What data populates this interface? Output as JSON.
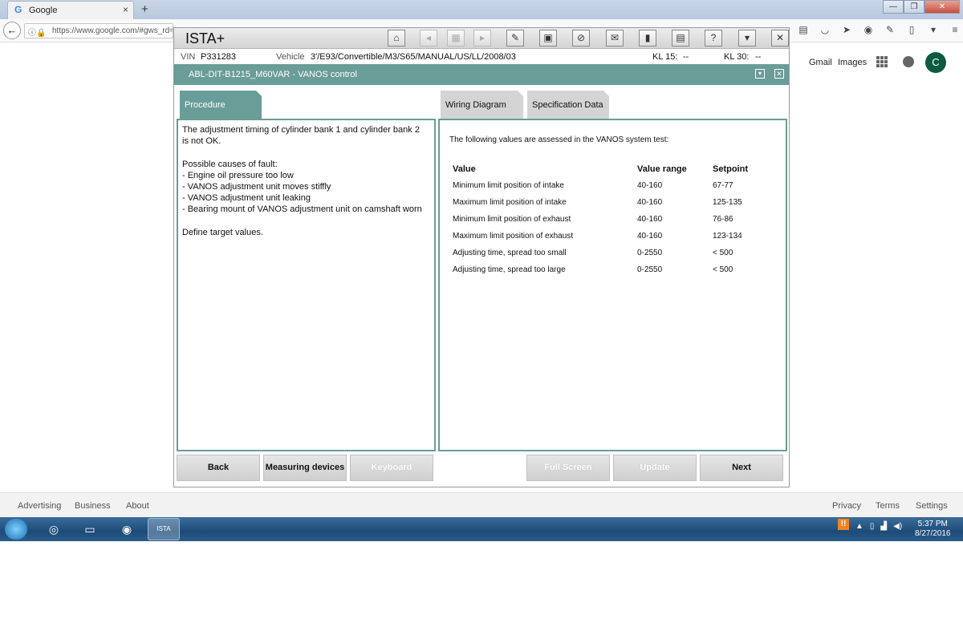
{
  "browser": {
    "tab_title": "Google",
    "tab_close": "×",
    "new_tab": "+",
    "url": "https://www.google.com/#gws_rd=ss",
    "window_controls": [
      "—",
      "❐",
      "✕"
    ]
  },
  "google": {
    "gmail": "Gmail",
    "images": "Images",
    "avatar_letter": "C",
    "footer_left": [
      "Advertising",
      "Business",
      "About"
    ],
    "footer_right": [
      "Privacy",
      "Terms",
      "Settings"
    ]
  },
  "ista": {
    "app_title": "ISTA+",
    "toolbar_icons": [
      "home-icon",
      "back-icon",
      "document-icon",
      "forward-icon",
      "wrench-icon",
      "vehicle-icon",
      "diagnosis-icon",
      "mail-icon",
      "battery-icon",
      "print-icon",
      "help-icon",
      "minimize-icon",
      "close-icon"
    ],
    "vin_label": "VIN",
    "vin_value": "P331283",
    "vehicle_label": "Vehicle",
    "vehicle_value": "3'/E93/Convertible/M3/S65/MANUAL/US/LL/2008/03",
    "kl15_label": "KL 15:",
    "kl15_value": "--",
    "kl30_label": "KL 30:",
    "kl30_value": "--",
    "header_title": "ABL-DIT-B1215_M60VAR  -  VANOS control",
    "tabs": {
      "procedure": "Procedure",
      "wiring": "Wiring Diagram",
      "spec": "Specification Data"
    },
    "procedure_text": "The adjustment timing of cylinder bank 1 and cylinder bank 2\nis not OK.\n\nPossible causes of fault:\n- Engine oil pressure too low\n- VANOS adjustment unit moves stiffly\n- VANOS adjustment unit leaking\n- Bearing mount of VANOS adjustment unit on camshaft worn\n\nDefine target values.",
    "spec_intro": "The following values are assessed in the VANOS system test:",
    "spec_headers": [
      "Value",
      "Value range",
      "Setpoint"
    ],
    "spec_rows": [
      [
        "Minimum limit position of intake",
        "40-160",
        "67-77"
      ],
      [
        "Maximum limit position of intake",
        "40-160",
        "125-135"
      ],
      [
        "Minimum limit position of exhaust",
        "40-160",
        "76-86"
      ],
      [
        "Maximum limit position of exhaust",
        "40-160",
        "123-134"
      ],
      [
        "Adjusting time, spread too small",
        "0-2550",
        "< 500"
      ],
      [
        "Adjusting time, spread too large",
        "0-2550",
        "< 500"
      ]
    ],
    "buttons": {
      "back": "Back",
      "measuring": "Measuring devices",
      "keyboard": "Keyboard",
      "fullscreen": "Full Screen",
      "update": "Update",
      "next": "Next"
    }
  },
  "taskbar": {
    "time": "5:37 PM",
    "date": "8/27/2016",
    "ista_label": "ISTA"
  }
}
